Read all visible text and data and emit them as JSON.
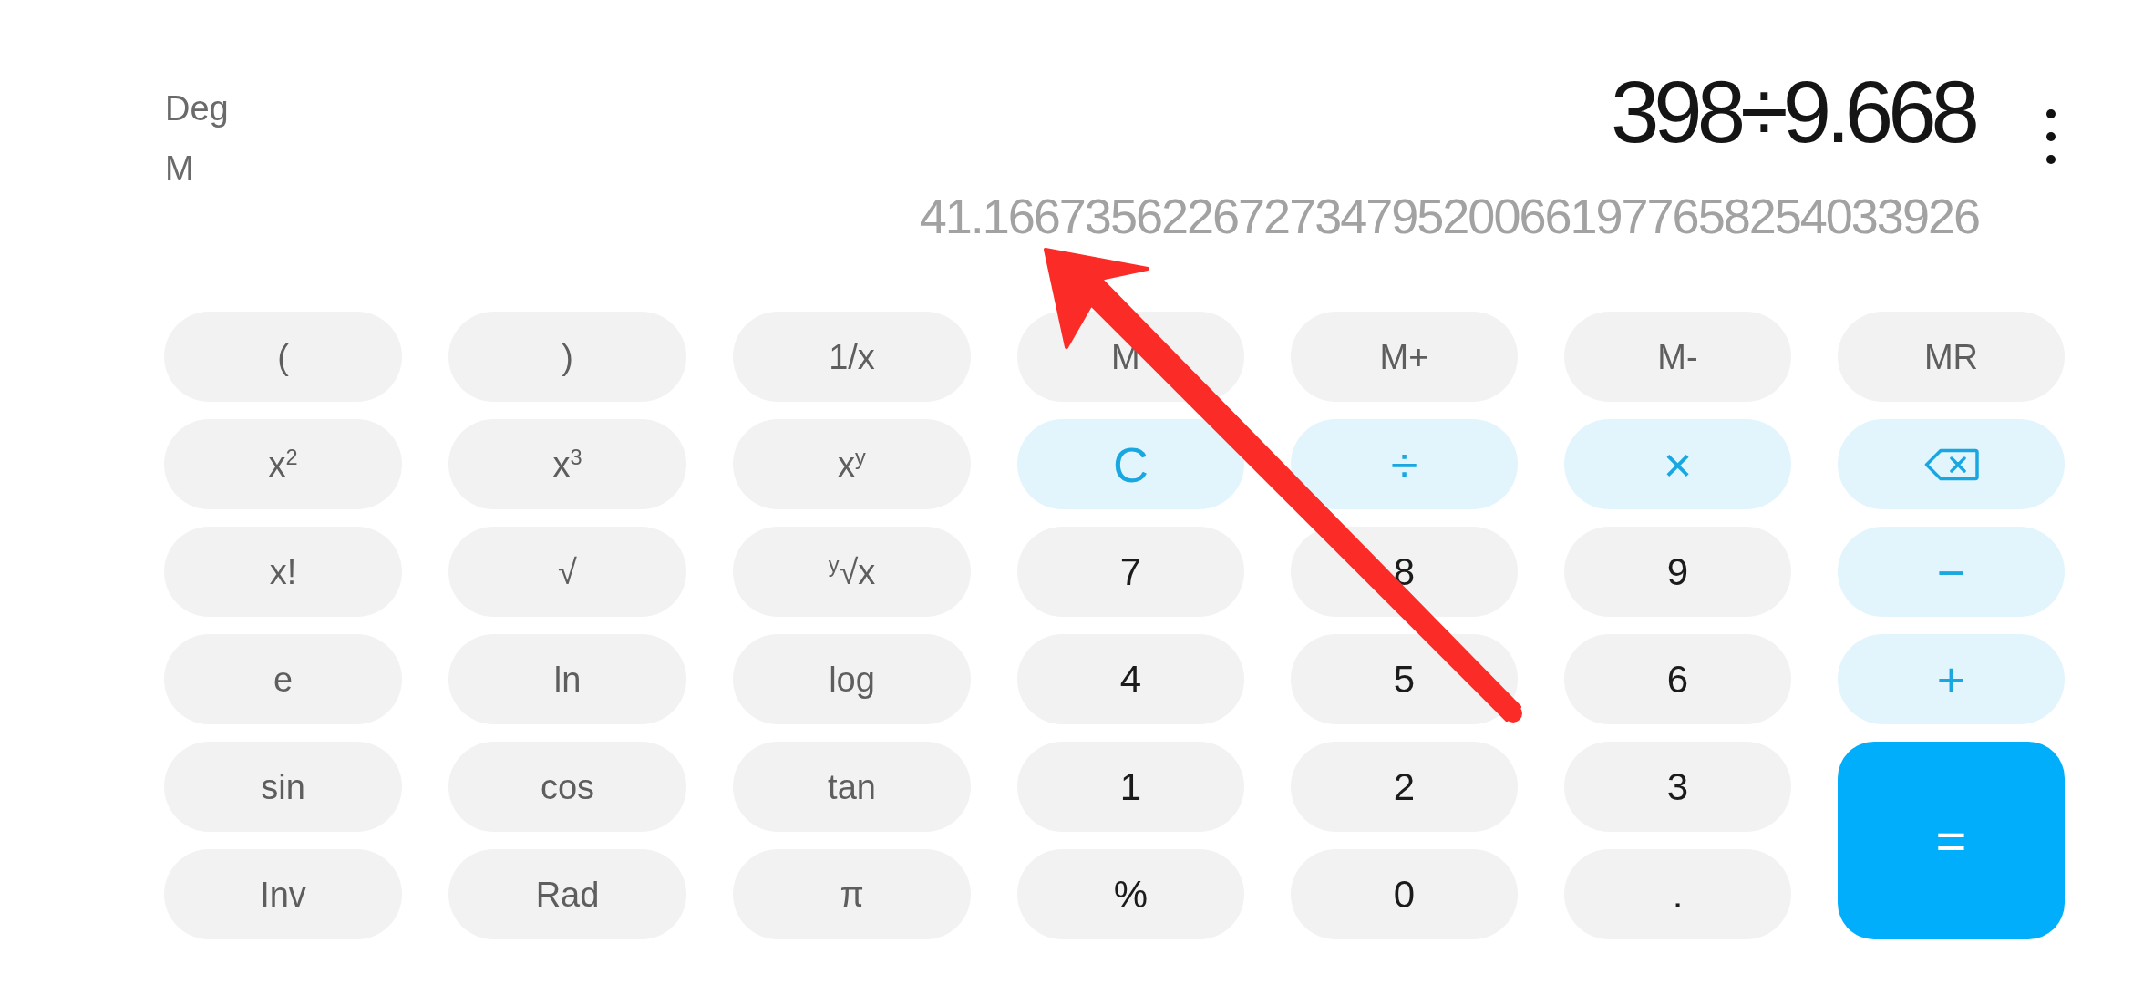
{
  "display": {
    "angle_mode": "Deg",
    "memory_indicator": "M",
    "expression": "398÷9.668",
    "result": "41.166735622672734795200661977658254033926"
  },
  "keypad": {
    "rows": [
      [
        {
          "label": "(",
          "kind": "function",
          "covered": false
        },
        {
          "label": ")",
          "kind": "function",
          "covered": false
        },
        {
          "label": "1/x",
          "kind": "function",
          "covered": false
        },
        {
          "label": "M",
          "kind": "memory",
          "covered": true
        },
        {
          "label": "M+",
          "kind": "memory",
          "covered": false
        },
        {
          "label": "M-",
          "kind": "memory",
          "covered": false
        },
        {
          "label": "MR",
          "kind": "memory",
          "covered": false
        }
      ],
      [
        {
          "label": "x$^{2}$",
          "kind": "function",
          "covered": false
        },
        {
          "label": "x$^{3}$",
          "kind": "function",
          "covered": false
        },
        {
          "label": "x$^{y}$",
          "kind": "function",
          "covered": false
        },
        {
          "label": "C",
          "kind": "clear",
          "covered": false
        },
        {
          "label": "÷",
          "kind": "operator",
          "covered": false
        },
        {
          "label": "×",
          "kind": "operator",
          "covered": false
        },
        {
          "kind": "backspace",
          "covered": false
        }
      ],
      [
        {
          "label": "x!",
          "kind": "function",
          "covered": false
        },
        {
          "label": "√",
          "kind": "function",
          "covered": false
        },
        {
          "label": "$^{y}$√x",
          "kind": "function",
          "covered": false
        },
        {
          "label": "7",
          "kind": "digit",
          "covered": false
        },
        {
          "label": "8",
          "kind": "digit",
          "covered": false
        },
        {
          "label": "9",
          "kind": "digit",
          "covered": false
        },
        {
          "label": "−",
          "kind": "operator",
          "covered": false
        }
      ],
      [
        {
          "label": "e",
          "kind": "function",
          "covered": false
        },
        {
          "label": "ln",
          "kind": "function",
          "covered": false
        },
        {
          "label": "log",
          "kind": "function",
          "covered": false
        },
        {
          "label": "4",
          "kind": "digit",
          "covered": false
        },
        {
          "label": "5",
          "kind": "digit",
          "covered": false
        },
        {
          "label": "6",
          "kind": "digit",
          "covered": false
        },
        {
          "label": "+",
          "kind": "operator",
          "covered": false
        }
      ],
      [
        {
          "label": "sin",
          "kind": "function",
          "covered": false
        },
        {
          "label": "cos",
          "kind": "function",
          "covered": false
        },
        {
          "label": "tan",
          "kind": "function",
          "covered": false
        },
        {
          "label": "1",
          "kind": "digit",
          "covered": false
        },
        {
          "label": "2",
          "kind": "digit",
          "covered": false
        },
        {
          "label": "3",
          "kind": "digit",
          "covered": false
        },
        {
          "label": "=",
          "kind": "equals",
          "covered": false
        }
      ],
      [
        {
          "label": "Inv",
          "kind": "function",
          "covered": false
        },
        {
          "label": "Rad",
          "kind": "function",
          "covered": false
        },
        {
          "label": "π",
          "kind": "function",
          "covered": false
        },
        {
          "label": "%",
          "kind": "digit",
          "covered": false
        },
        {
          "label": "0",
          "kind": "digit",
          "covered": false
        },
        {
          "label": ".",
          "kind": "digit",
          "covered": false
        }
      ]
    ]
  },
  "annotations": [
    {
      "kind": "arrow"
    }
  ]
}
